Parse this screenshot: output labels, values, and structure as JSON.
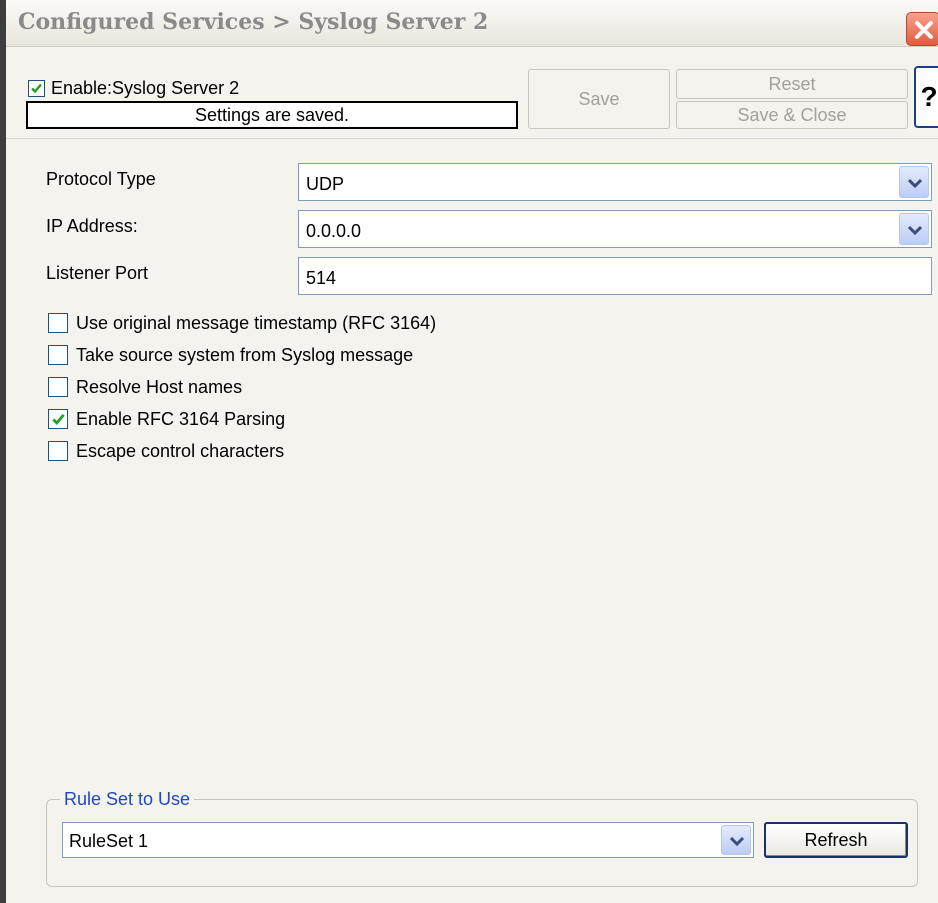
{
  "window": {
    "title": "Configured Services > Syslog Server 2"
  },
  "toolbar": {
    "enable_label": "Enable:Syslog Server 2",
    "enable_checked": true,
    "status_text": "Settings are saved.",
    "save_label": "Save",
    "reset_label": "Reset",
    "save_close_label": "Save & Close",
    "help_label": "?"
  },
  "form": {
    "protocol_type": {
      "label": "Protocol Type",
      "value": "UDP"
    },
    "ip_address": {
      "label": "IP Address:",
      "value": "0.0.0.0"
    },
    "listener_port": {
      "label": "Listener Port",
      "value": "514"
    }
  },
  "options": [
    {
      "label": "Use original message timestamp (RFC 3164)",
      "checked": false
    },
    {
      "label": "Take source system from Syslog message",
      "checked": false
    },
    {
      "label": "Resolve Host names",
      "checked": false
    },
    {
      "label": "Enable RFC 3164 Parsing",
      "checked": true
    },
    {
      "label": "Escape control characters",
      "checked": false
    }
  ],
  "ruleset": {
    "group_label": "Rule Set to Use",
    "selected": "RuleSet 1",
    "refresh_label": "Refresh"
  },
  "icons": {
    "close": "close-icon",
    "check": "checkmark-icon",
    "dropdown": "chevron-down-icon"
  },
  "colors": {
    "title_text": "#8a8a8a",
    "group_label": "#1d48c8",
    "check_green": "#21a121",
    "close_red": "#e35b3d"
  }
}
